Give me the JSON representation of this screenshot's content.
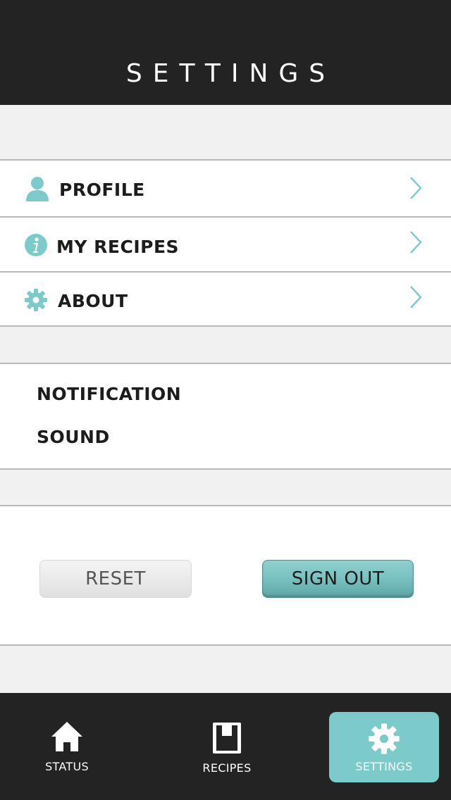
{
  "header": {
    "title": "SETTINGS"
  },
  "menu": {
    "items": [
      {
        "label": "PROFILE",
        "icon": "user-icon"
      },
      {
        "label": "MY RECIPES",
        "icon": "info-icon"
      },
      {
        "label": "ABOUT",
        "icon": "gear-icon"
      }
    ]
  },
  "preferences": {
    "notification_label": "NOTIFICATION",
    "sound_label": "SOUND"
  },
  "actions": {
    "reset_label": "RESET",
    "signout_label": "SIGN OUT"
  },
  "tabbar": {
    "tabs": [
      {
        "label": "STATUS",
        "icon": "home-icon",
        "active": false
      },
      {
        "label": "RECIPES",
        "icon": "book-icon",
        "active": false
      },
      {
        "label": "SETTINGS",
        "icon": "gear-icon",
        "active": true
      }
    ]
  },
  "colors": {
    "accent": "#7ccbca",
    "dark": "#232323",
    "background": "#f1f1f1"
  }
}
